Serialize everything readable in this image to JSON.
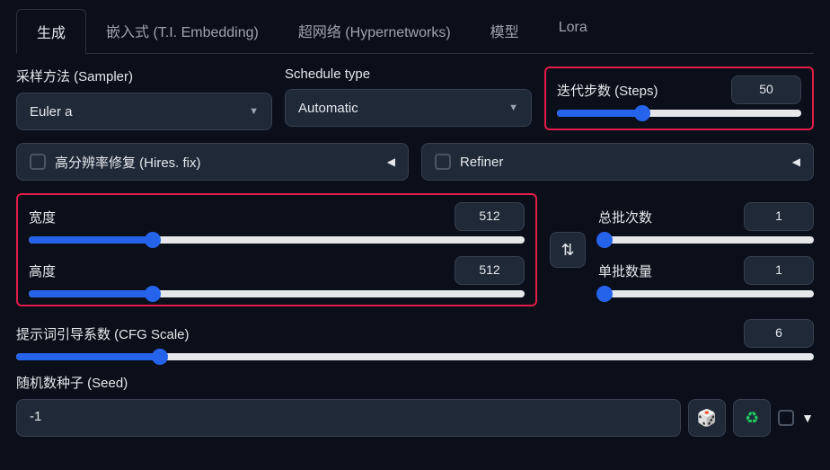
{
  "tabs": {
    "generate": "生成",
    "embedding": "嵌入式 (T.I. Embedding)",
    "hypernetworks": "超网络 (Hypernetworks)",
    "model": "模型",
    "lora": "Lora"
  },
  "sampler": {
    "label": "采样方法 (Sampler)",
    "value": "Euler a"
  },
  "schedule": {
    "label": "Schedule type",
    "value": "Automatic"
  },
  "steps": {
    "label": "迭代步数 (Steps)",
    "value": "50",
    "fill": "35%"
  },
  "hires": {
    "label": "高分辨率修复 (Hires. fix)"
  },
  "refiner": {
    "label": "Refiner"
  },
  "width": {
    "label": "宽度",
    "value": "512",
    "fill": "25%"
  },
  "height": {
    "label": "高度",
    "value": "512",
    "fill": "25%"
  },
  "batch_count": {
    "label": "总批次数",
    "value": "1",
    "fill": "3%"
  },
  "batch_size": {
    "label": "单批数量",
    "value": "1",
    "fill": "3%"
  },
  "cfg": {
    "label": "提示词引导系数 (CFG Scale)",
    "value": "6",
    "fill": "18%"
  },
  "seed": {
    "label": "随机数种子 (Seed)",
    "value": "-1"
  },
  "icons": {
    "swap": "⇅",
    "dice": "🎲",
    "recycle": "♻",
    "triangle": "◀",
    "triangle_down": "▼",
    "caret": "▼"
  }
}
